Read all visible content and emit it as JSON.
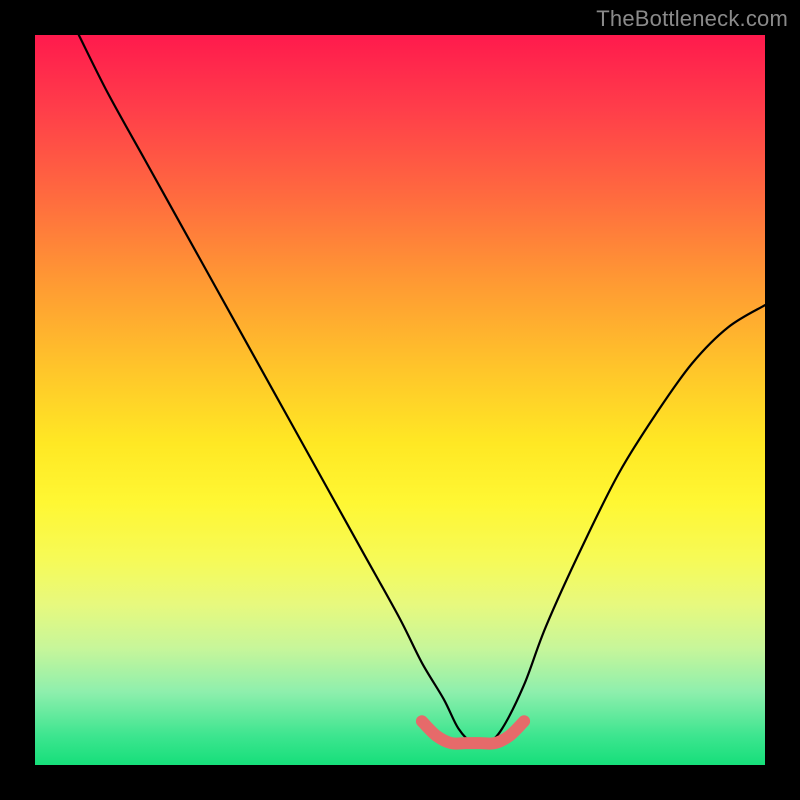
{
  "watermark": "TheBottleneck.com",
  "chart_data": {
    "type": "line",
    "title": "",
    "xlabel": "",
    "ylabel": "",
    "xlim": [
      0,
      100
    ],
    "ylim": [
      0,
      100
    ],
    "series": [
      {
        "name": "main-curve",
        "x": [
          6,
          10,
          15,
          20,
          25,
          30,
          35,
          40,
          45,
          50,
          53,
          56,
          58,
          60,
          62,
          64,
          67,
          70,
          75,
          80,
          85,
          90,
          95,
          100
        ],
        "y": [
          100,
          92,
          83,
          74,
          65,
          56,
          47,
          38,
          29,
          20,
          14,
          9,
          5,
          3,
          3,
          5,
          11,
          19,
          30,
          40,
          48,
          55,
          60,
          63
        ]
      },
      {
        "name": "valley-marker",
        "x": [
          53,
          55,
          57,
          59,
          61,
          63,
          65,
          67
        ],
        "y": [
          6,
          4,
          3,
          3,
          3,
          3,
          4,
          6
        ]
      }
    ]
  }
}
